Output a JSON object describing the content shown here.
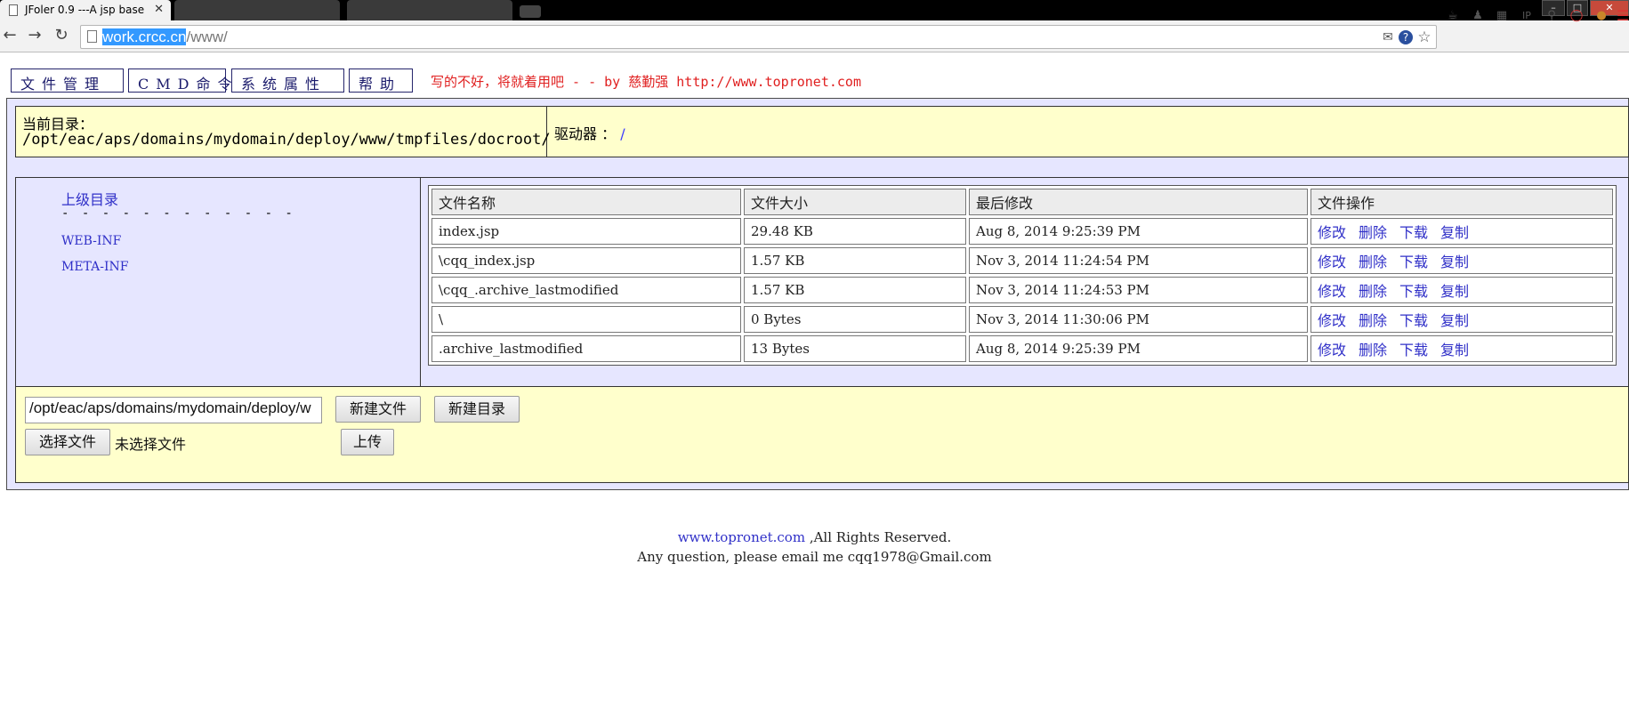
{
  "browser": {
    "tab_title": "JFoler 0.9 ---A jsp base",
    "tab_close": "✕",
    "url_host": "work.crcc.cn",
    "url_path": "/www/"
  },
  "nav": {
    "file_manage": "文件管理",
    "cmd": "CMD命令",
    "sys_props": "系统属性",
    "help": "帮助"
  },
  "slogan": "写的不好，将就着用吧 - - by 慈勤强 http://www.topronet.com",
  "current_dir": {
    "label": "当前目录：",
    "path": "/opt/eac/aps/domains/mydomain/deploy/www/tmpfiles/docroot/",
    "drive_label": "驱动器 ：",
    "drive_value": "/"
  },
  "tree": {
    "parent": "上级目录",
    "separator": "- - - - - - - - - - - -",
    "items": [
      "WEB-INF",
      "META-INF"
    ]
  },
  "table": {
    "headers": [
      "文件名称",
      "文件大小",
      "最后修改",
      "文件操作"
    ],
    "rows": [
      {
        "name": "index.jsp",
        "size": "29.48 KB",
        "modified": "Aug 8, 2014 9:25:39 PM"
      },
      {
        "name": "\\cqq_index.jsp",
        "size": "1.57 KB",
        "modified": "Nov 3, 2014 11:24:54 PM"
      },
      {
        "name": "\\cqq_.archive_lastmodified",
        "size": "1.57 KB",
        "modified": "Nov 3, 2014 11:24:53 PM"
      },
      {
        "name": "\\",
        "size": "0 Bytes",
        "modified": "Nov 3, 2014 11:30:06 PM"
      },
      {
        "name": ".archive_lastmodified",
        "size": "13 Bytes",
        "modified": "Aug 8, 2014 9:25:39 PM"
      }
    ],
    "ops": {
      "edit": "修改",
      "delete": "删除",
      "download": "下载",
      "copy": "复制"
    }
  },
  "form": {
    "path_value": "/opt/eac/aps/domains/mydomain/deploy/w",
    "new_file": "新建文件",
    "new_dir": "新建目录",
    "choose_file": "选择文件",
    "no_file": "未选择文件",
    "upload": "上传"
  },
  "footer": {
    "link": "www.topronet.com",
    "rights": " ,All Rights Reserved.",
    "contact": "Any question, please email me cqq1978@Gmail.com"
  }
}
